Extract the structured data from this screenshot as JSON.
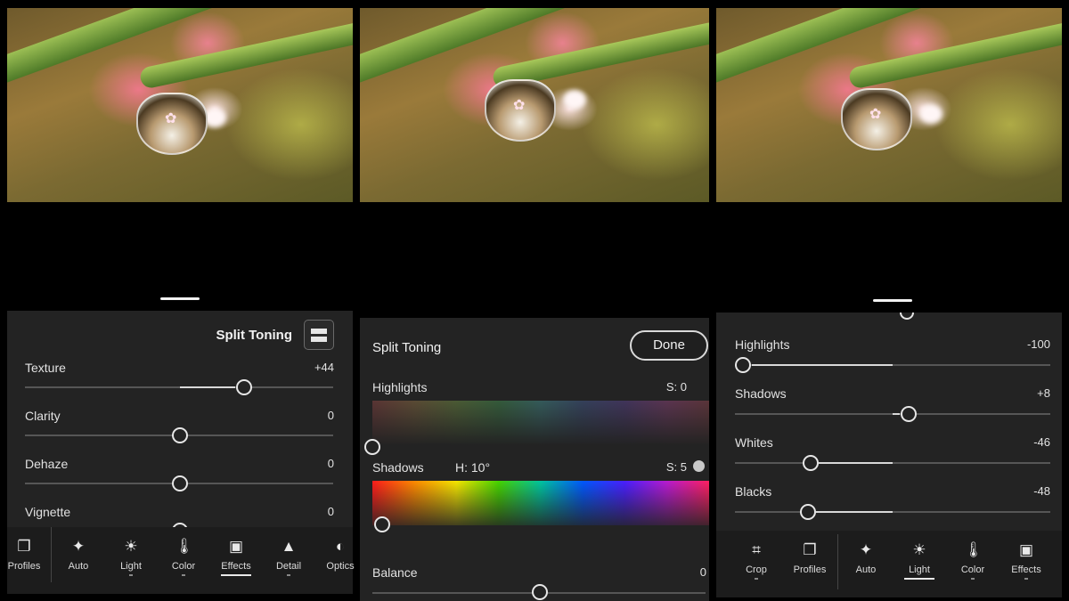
{
  "panel1": {
    "title": "Split Toning",
    "rows": [
      {
        "label": "Texture",
        "value": "+44"
      },
      {
        "label": "Clarity",
        "value": "0"
      },
      {
        "label": "Dehaze",
        "value": "0"
      },
      {
        "label": "Vignette",
        "value": "0"
      }
    ],
    "toolbar": [
      {
        "label": "Profiles",
        "icon": "profiles-icon"
      },
      {
        "label": "Auto",
        "icon": "auto-icon"
      },
      {
        "label": "Light",
        "icon": "light-icon"
      },
      {
        "label": "Color",
        "icon": "color-icon"
      },
      {
        "label": "Effects",
        "icon": "effects-icon",
        "active": true
      },
      {
        "label": "Detail",
        "icon": "detail-icon"
      },
      {
        "label": "Optics",
        "icon": "optics-icon"
      }
    ]
  },
  "panel2": {
    "title": "Split Toning",
    "done_label": "Done",
    "highlights": {
      "label": "Highlights",
      "saturation": "S: 0"
    },
    "shadows": {
      "label": "Shadows",
      "hue": "H: 10°",
      "saturation": "S: 5"
    },
    "balance": {
      "label": "Balance",
      "value": "0"
    }
  },
  "panel3": {
    "rows": [
      {
        "label": "Highlights",
        "value": "-100"
      },
      {
        "label": "Shadows",
        "value": "+8"
      },
      {
        "label": "Whites",
        "value": "-46"
      },
      {
        "label": "Blacks",
        "value": "-48"
      }
    ],
    "toolbar": [
      {
        "label": "Crop",
        "icon": "crop-icon"
      },
      {
        "label": "Profiles",
        "icon": "profiles-icon"
      },
      {
        "label": "Auto",
        "icon": "auto-icon"
      },
      {
        "label": "Light",
        "icon": "light-icon",
        "active": true
      },
      {
        "label": "Color",
        "icon": "color-icon"
      },
      {
        "label": "Effects",
        "icon": "effects-icon"
      }
    ]
  }
}
